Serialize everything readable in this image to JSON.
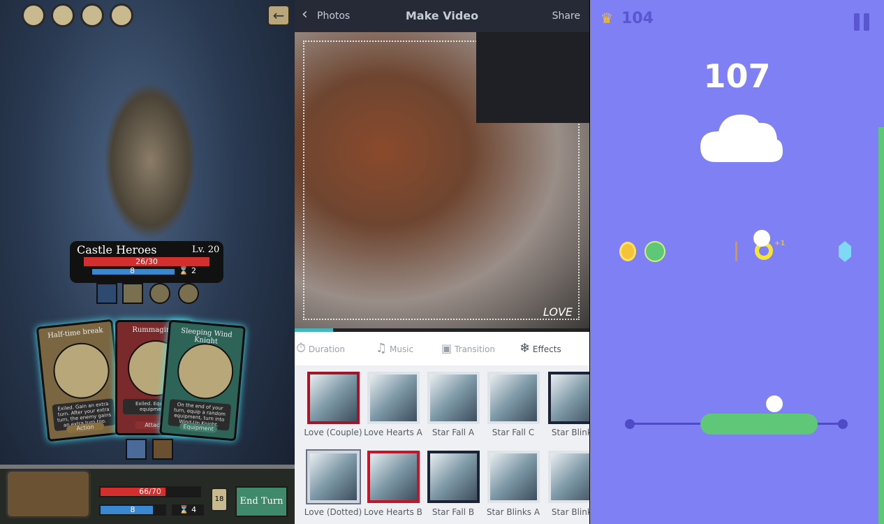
{
  "card_game": {
    "hero_name": "Castle Heroes",
    "level": "Lv. 20",
    "hero_hp": "26/30",
    "hero_mana": "8",
    "hero_timer": "2",
    "cards": [
      {
        "title": "Half-time break",
        "text": "Exiled. Gain an extra turn. After your extra turn, the enemy gains an extra turn too.",
        "type": "Action"
      },
      {
        "title": "Rummaging",
        "text": "Exiled. Equip 2 equipment.",
        "type": "Attack"
      },
      {
        "title": "Sleeping Wind Knight",
        "text": "On the end of your turn, equip a random equipment, turn into Wind-Up Knight.",
        "type": "Equipment"
      }
    ],
    "player_hp": "66/70",
    "player_hp_fraction": 0.94,
    "player_mana": "8",
    "player_timer": "4",
    "deck_count": "18",
    "end_turn": "End Turn"
  },
  "video_app": {
    "back_label": "Photos",
    "title": "Make Video",
    "share_label": "Share",
    "progress": 0.13,
    "tabs": [
      {
        "label": "Duration",
        "icon": "stopwatch-icon"
      },
      {
        "label": "Music",
        "icon": "music-note-icon"
      },
      {
        "label": "Transition",
        "icon": "transition-icon"
      },
      {
        "label": "Effects",
        "icon": "snowflake-icon"
      }
    ],
    "effects_row1": [
      "Love (Couple)",
      "Love Hearts A",
      "Star Fall A",
      "Star Fall C",
      "Star Blinks"
    ],
    "effects_row2": [
      "Love (Dotted)",
      "Love Hearts B",
      "Star Fall B",
      "Star Blinks A",
      "Star Blinks"
    ],
    "photo_overlay_text": "LOVE",
    "accent": "#3fb8c0"
  },
  "arcade_game": {
    "best_score": "104",
    "score": "107",
    "bonus": "+1",
    "bg_color": "#7f80f4",
    "accent_green": "#5fc878"
  }
}
